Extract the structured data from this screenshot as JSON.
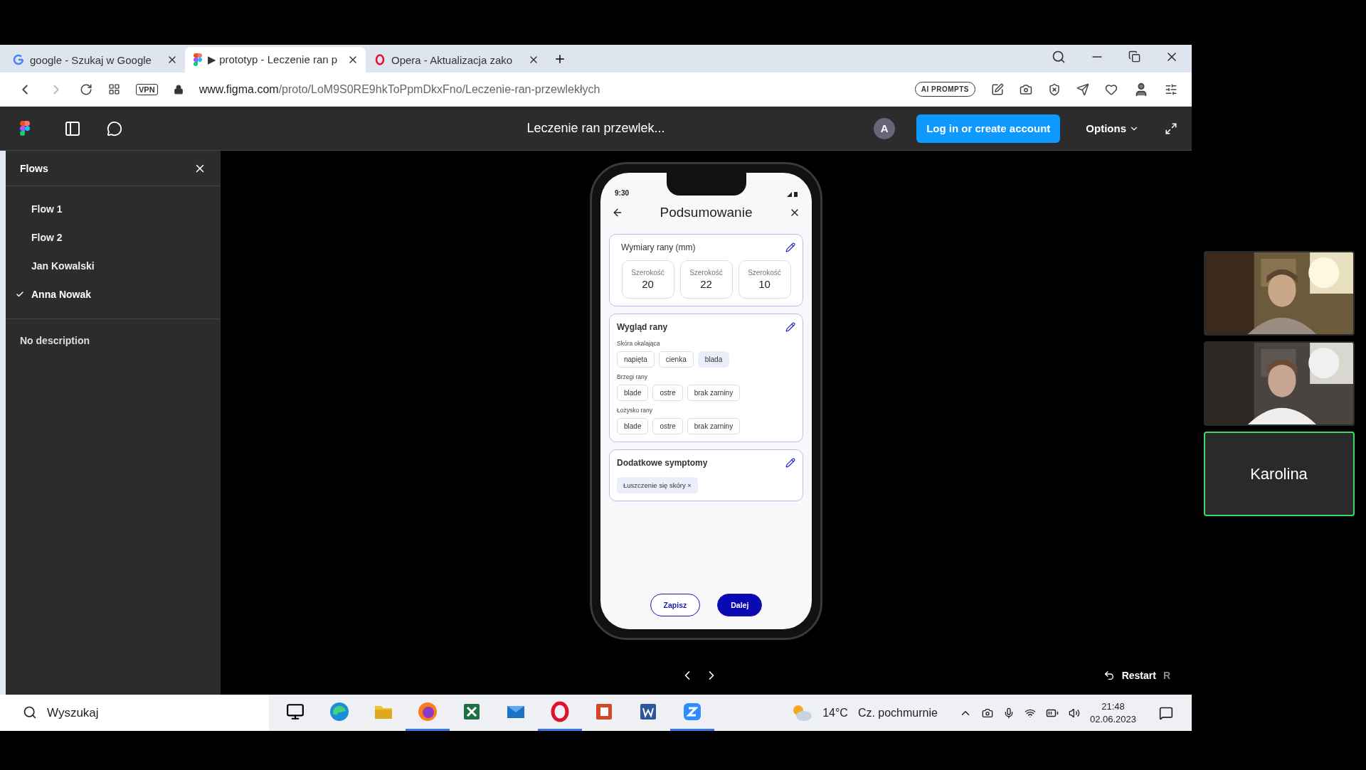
{
  "browser": {
    "tabs": [
      {
        "kind": "google",
        "title": "google - Szukaj w Google",
        "selected": false
      },
      {
        "kind": "figma",
        "title": "▶ prototyp - Leczenie ran p",
        "selected": true
      },
      {
        "kind": "opera",
        "title": "Opera - Aktualizacja zako",
        "selected": false
      }
    ],
    "url_host": "www.figma.com",
    "url_path": "/proto/LoM9S0RE9hkToPpmDkxFno/Leczenie-ran-przewlekłych",
    "vpn": "VPN",
    "ai_prompts": "AI PROMPTS"
  },
  "figma": {
    "title": "Leczenie ran przewlek...",
    "avatar": "A",
    "login": "Log in or create account",
    "options": "Options",
    "flows_title": "Flows",
    "flows": [
      {
        "label": "Flow 1",
        "selected": false
      },
      {
        "label": "Flow 2",
        "selected": false
      },
      {
        "label": "Jan Kowalski",
        "selected": false
      },
      {
        "label": "Anna Nowak",
        "selected": true
      }
    ],
    "description": "No description",
    "restart": "Restart",
    "restart_key": "R"
  },
  "phone": {
    "time": "9:30",
    "title": "Podsumowanie",
    "dimensions": {
      "title": "Wymiary rany (mm)",
      "items": [
        {
          "label": "Szerokość",
          "value": "20"
        },
        {
          "label": "Szerokość",
          "value": "22"
        },
        {
          "label": "Szerokość",
          "value": "10"
        }
      ]
    },
    "appearance": {
      "title": "Wygląd rany",
      "groups": [
        {
          "label": "Skóra okalająca",
          "chips": [
            {
              "label": "napięta",
              "selected": false
            },
            {
              "label": "cienka",
              "selected": false
            },
            {
              "label": "blada",
              "selected": true
            }
          ]
        },
        {
          "label": "Brzegi rany",
          "chips": [
            {
              "label": "blade",
              "selected": false
            },
            {
              "label": "ostre",
              "selected": false
            },
            {
              "label": "brak zarniny",
              "selected": false
            }
          ]
        },
        {
          "label": "Łożysko rany",
          "chips": [
            {
              "label": "blade",
              "selected": false
            },
            {
              "label": "ostre",
              "selected": false
            },
            {
              "label": "brak zarniny",
              "selected": false
            }
          ]
        }
      ]
    },
    "symptoms": {
      "title": "Dodatkowe symptomy",
      "tags": [
        {
          "label": "Łuszczenie się skóry",
          "remove": "×"
        }
      ]
    },
    "buttons": [
      {
        "kind": "outline",
        "label": "Zapisz"
      },
      {
        "kind": "filled",
        "label": "Dalej"
      }
    ]
  },
  "taskbar": {
    "search_placeholder": "Wyszukaj",
    "apps": [
      {
        "kind": "tasks",
        "running": false
      },
      {
        "kind": "edge",
        "running": false
      },
      {
        "kind": "folder",
        "running": false
      },
      {
        "kind": "firefox",
        "running": true
      },
      {
        "kind": "excel",
        "running": false
      },
      {
        "kind": "mail",
        "running": false
      },
      {
        "kind": "opera",
        "running": true
      },
      {
        "kind": "powerpoint",
        "running": false
      },
      {
        "kind": "word",
        "running": false
      },
      {
        "kind": "zoom",
        "running": true
      }
    ],
    "temperature": "14°C",
    "weather": "Cz. pochmurnie",
    "time": "21:48",
    "date": "02.06.2023"
  },
  "participants": [
    {
      "kind": "picture",
      "active": false
    },
    {
      "kind": "picture",
      "active": false
    },
    {
      "kind": "name",
      "name": "Karolina",
      "active": true
    }
  ]
}
